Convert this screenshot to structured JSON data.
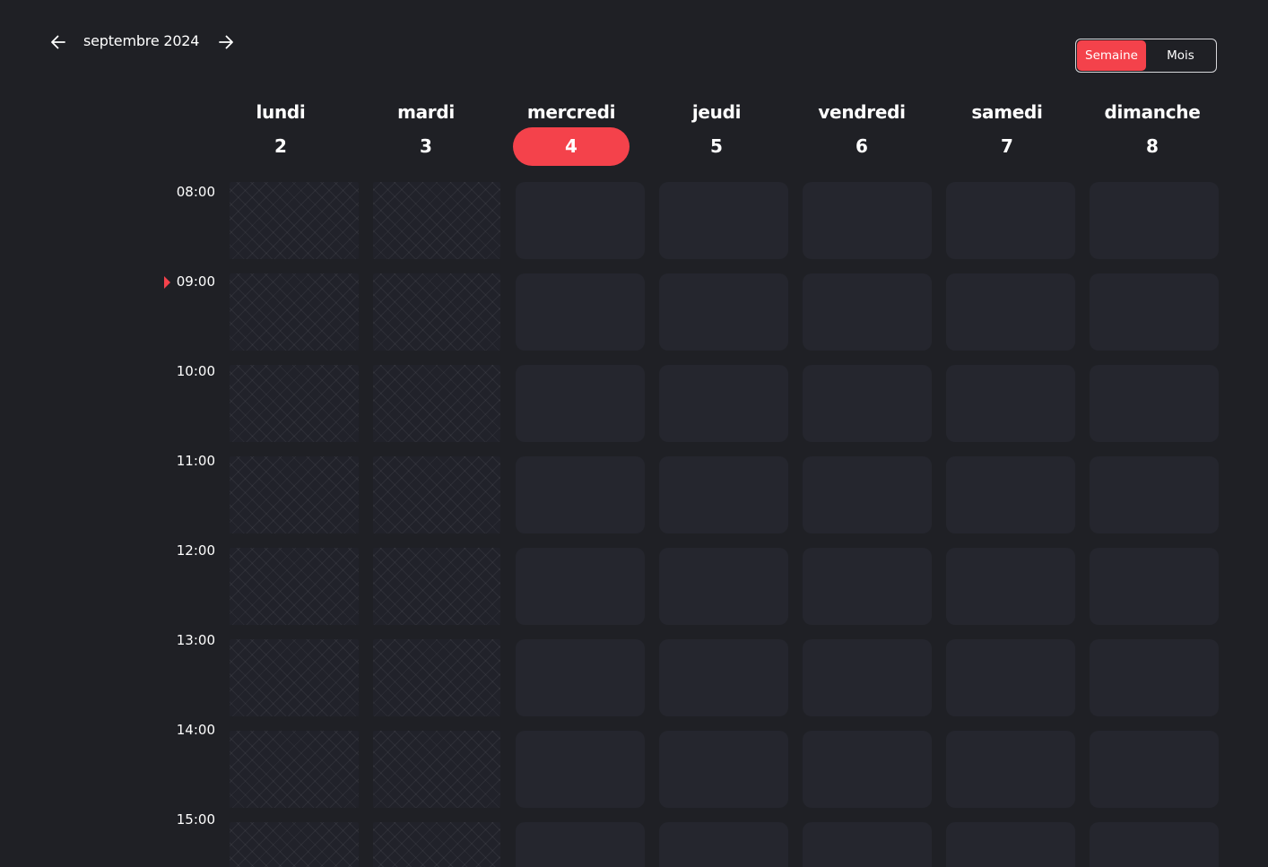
{
  "header": {
    "month_label": "septembre 2024",
    "prev_icon": "arrow-left-icon",
    "next_icon": "arrow-right-icon"
  },
  "view_toggle": {
    "options": [
      "Semaine",
      "Mois"
    ],
    "selected": "Semaine"
  },
  "days": [
    {
      "name": "lundi",
      "number": "2",
      "today": false,
      "blocked": true
    },
    {
      "name": "mardi",
      "number": "3",
      "today": false,
      "blocked": true
    },
    {
      "name": "mercredi",
      "number": "4",
      "today": true,
      "blocked": false
    },
    {
      "name": "jeudi",
      "number": "5",
      "today": false,
      "blocked": false
    },
    {
      "name": "vendredi",
      "number": "6",
      "today": false,
      "blocked": false
    },
    {
      "name": "samedi",
      "number": "7",
      "today": false,
      "blocked": false
    },
    {
      "name": "dimanche",
      "number": "8",
      "today": false,
      "blocked": false
    }
  ],
  "hours": [
    "08:00",
    "09:00",
    "10:00",
    "11:00",
    "12:00",
    "13:00",
    "14:00",
    "15:00"
  ],
  "current_hour": "09:00",
  "colors": {
    "background": "#1f2025",
    "accent": "#f4424b",
    "slot": "#25262e",
    "toggle_border": "#d8d8dc"
  }
}
